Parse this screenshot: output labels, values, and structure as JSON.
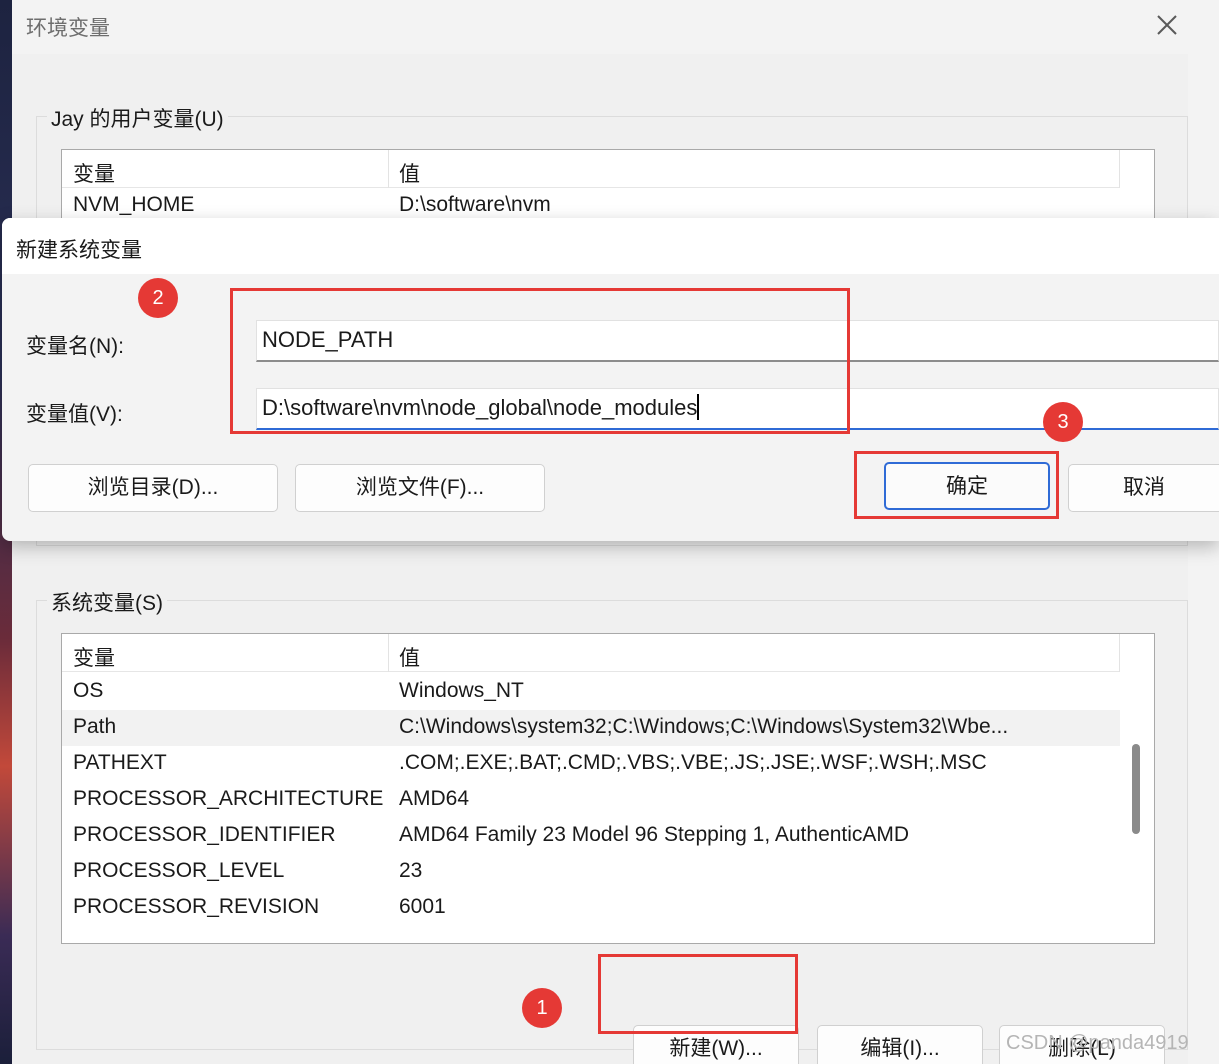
{
  "window": {
    "title": "环境变量"
  },
  "user_vars": {
    "legend": "Jay 的用户变量(U)",
    "columns": [
      "变量",
      "值"
    ],
    "rows": [
      {
        "name": "NVM_HOME",
        "value": "D:\\software\\nvm"
      }
    ]
  },
  "system_vars": {
    "legend": "系统变量(S)",
    "columns": [
      "变量",
      "值"
    ],
    "rows": [
      {
        "name": "OS",
        "value": "Windows_NT"
      },
      {
        "name": "Path",
        "value": "C:\\Windows\\system32;C:\\Windows;C:\\Windows\\System32\\Wbe..."
      },
      {
        "name": "PATHEXT",
        "value": ".COM;.EXE;.BAT;.CMD;.VBS;.VBE;.JS;.JSE;.WSF;.WSH;.MSC"
      },
      {
        "name": "PROCESSOR_ARCHITECTURE",
        "value": "AMD64"
      },
      {
        "name": "PROCESSOR_IDENTIFIER",
        "value": "AMD64 Family 23 Model 96 Stepping 1, AuthenticAMD"
      },
      {
        "name": "PROCESSOR_LEVEL",
        "value": "23"
      },
      {
        "name": "PROCESSOR_REVISION",
        "value": "6001"
      }
    ],
    "selected_row": "Path",
    "buttons": {
      "new": "新建(W)...",
      "edit": "编辑(I)...",
      "delete": "删除(L)"
    }
  },
  "dialog": {
    "title": "新建系统变量",
    "name_label": "变量名(N):",
    "name_value": "NODE_PATH",
    "value_label": "变量值(V):",
    "value_value": "D:\\software\\nvm\\node_global\\node_modules",
    "buttons": {
      "browse_dir": "浏览目录(D)...",
      "browse_file": "浏览文件(F)...",
      "ok": "确定",
      "cancel": "取消"
    }
  },
  "annotations": {
    "badge1": "1",
    "badge2": "2",
    "badge3": "3",
    "color": "#e53935"
  },
  "watermark": "CSDN @panda4919",
  "icons": {
    "close": "close-icon"
  },
  "colors": {
    "accent": "#2f6bd6",
    "annotation": "#e53935"
  }
}
